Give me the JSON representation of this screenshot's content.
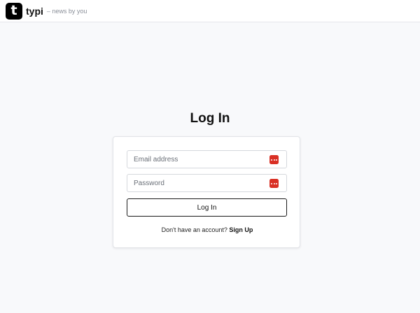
{
  "header": {
    "logo_letter": "t",
    "brand_name": "typi",
    "tagline": "– news by you"
  },
  "login": {
    "title": "Log In",
    "email_placeholder": "Email address",
    "password_placeholder": "Password",
    "button_label": "Log In",
    "signup_prompt": "Don't have an account?",
    "signup_link": "Sign Up"
  },
  "colors": {
    "password_manager_icon": "#d93025",
    "background": "#f8f9fb"
  },
  "icons": {
    "field_icon": "password-manager-icon"
  }
}
